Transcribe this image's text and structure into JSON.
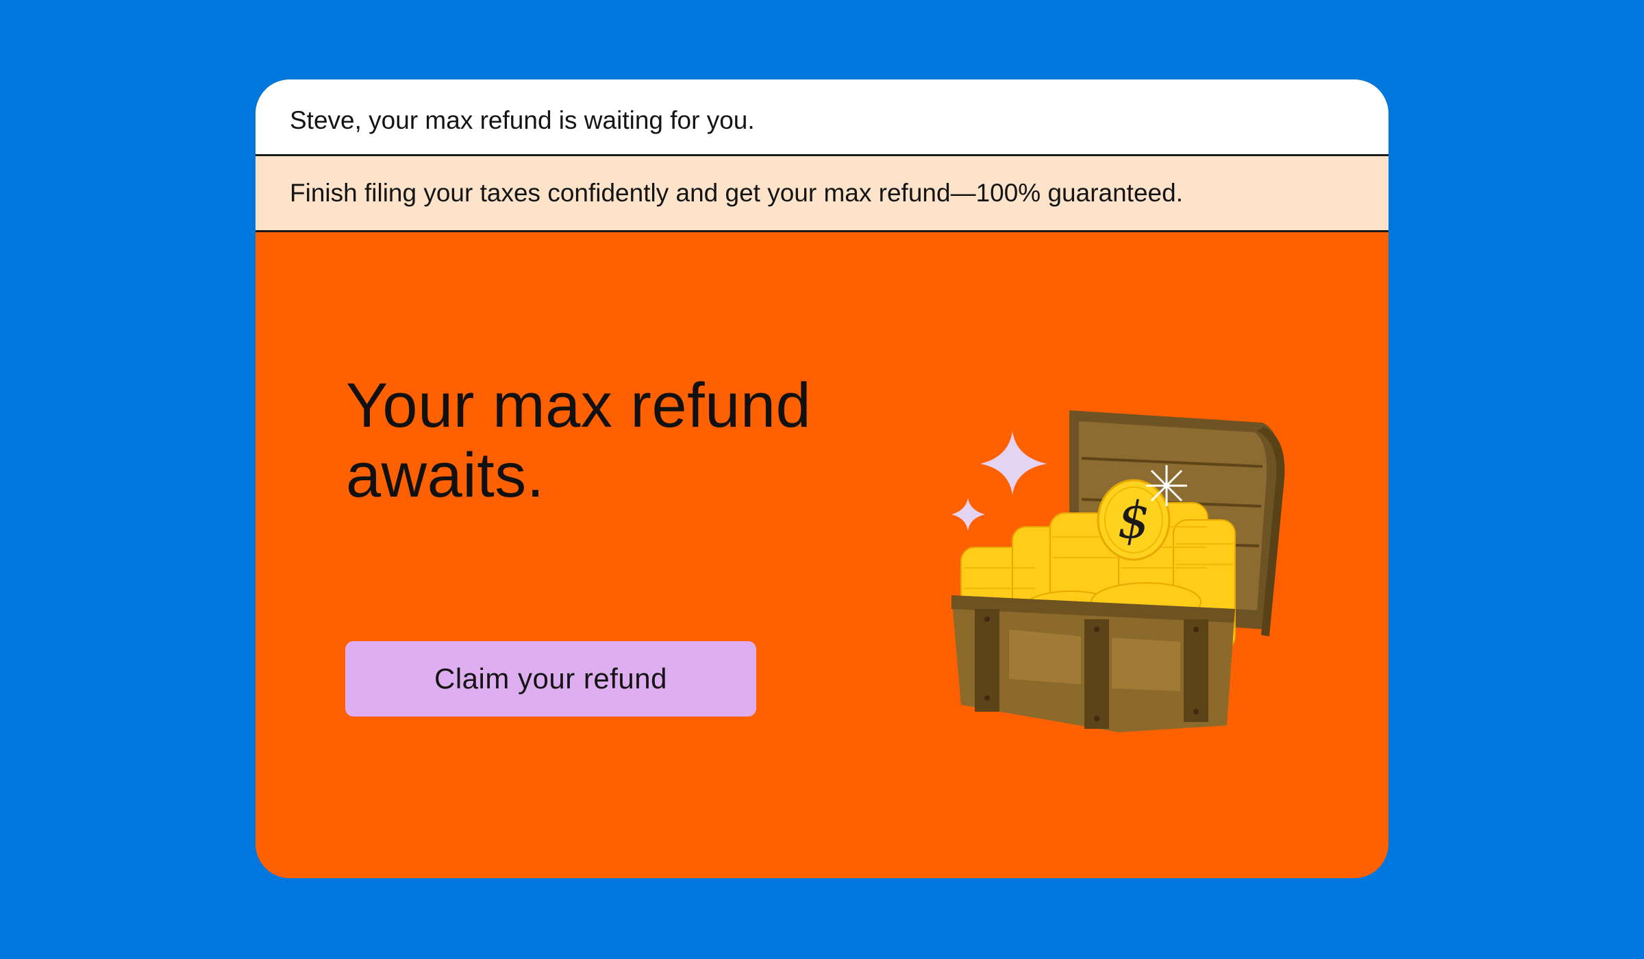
{
  "banner": {
    "greeting": "Steve, your max refund is waiting for you.",
    "promo": "Finish filing your taxes confidently and get your max refund—100% guaranteed."
  },
  "hero": {
    "headline": "Your max refund awaits.",
    "cta_label": "Claim your refund",
    "illustration": "treasure-chest-icon",
    "coin_symbol": "$"
  },
  "colors": {
    "page_background": "#0077dd",
    "hero_background": "#ff6000",
    "promo_background": "#fde3ca",
    "button_background": "#dfaef0",
    "sparkle": "#e4d4f4",
    "coin": "#ffcc1a",
    "chest": "#8a6a2c"
  }
}
